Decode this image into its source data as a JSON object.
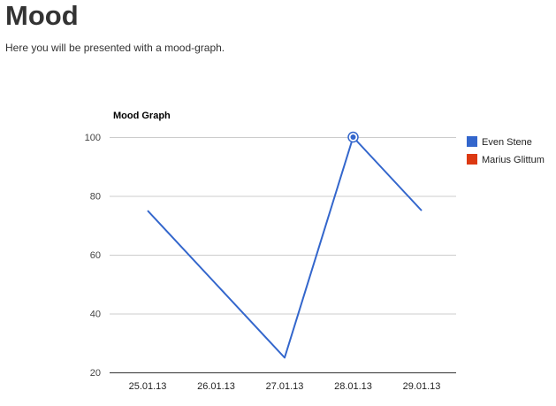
{
  "page": {
    "heading": "Mood",
    "intro": "Here you will be presented with a mood-graph."
  },
  "colors": {
    "series_1": "#3366cc",
    "series_2": "#dc3912",
    "grid": "#cccccc",
    "axis": "#333333",
    "text": "#222222",
    "label": "#444444"
  },
  "chart_data": {
    "type": "line",
    "title": "Mood Graph",
    "xlabel": "",
    "ylabel": "",
    "categories": [
      "25.01.13",
      "26.01.13",
      "27.01.13",
      "28.01.13",
      "29.01.13"
    ],
    "ylim": [
      20,
      100
    ],
    "yticks": [
      20,
      40,
      60,
      80,
      100
    ],
    "grid": true,
    "legend_position": "right",
    "series": [
      {
        "name": "Even Stene",
        "values": [
          75,
          50,
          25,
          100,
          75
        ],
        "highlighted_index": 3
      },
      {
        "name": "Marius Glittum",
        "values": []
      }
    ]
  }
}
